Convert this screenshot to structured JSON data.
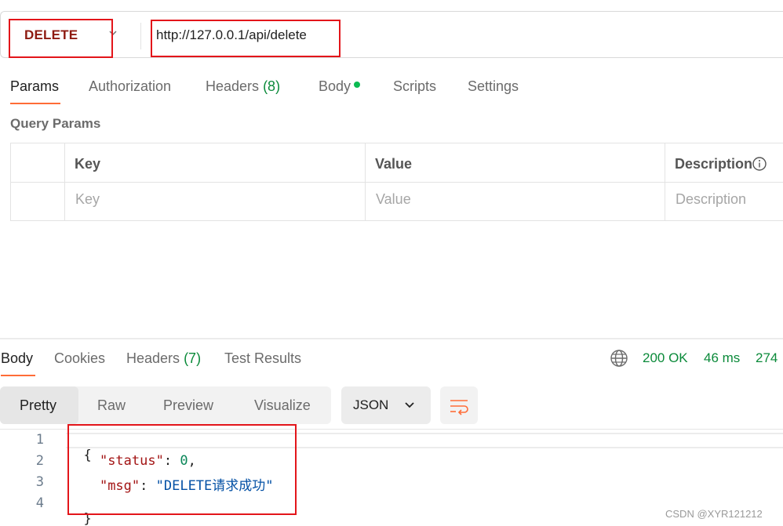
{
  "request": {
    "method": "DELETE",
    "url": "http://127.0.0.1/api/delete"
  },
  "request_tabs": {
    "params": "Params",
    "authorization": "Authorization",
    "headers": "Headers",
    "headers_count": "(8)",
    "body": "Body",
    "scripts": "Scripts",
    "settings": "Settings"
  },
  "query_params": {
    "title": "Query Params",
    "columns": [
      "Key",
      "Value",
      "Description"
    ],
    "placeholders": [
      "Key",
      "Value",
      "Description"
    ]
  },
  "response_tabs": {
    "body": "Body",
    "cookies": "Cookies",
    "headers": "Headers",
    "headers_count": "(7)",
    "test_results": "Test Results"
  },
  "response_status": {
    "status": "200 OK",
    "time": "46 ms",
    "size": "274"
  },
  "view_modes": [
    "Pretty",
    "Raw",
    "Preview",
    "Visualize"
  ],
  "format": "JSON",
  "code": {
    "line_numbers": [
      "1",
      "2",
      "3",
      "4"
    ],
    "open_brace": "{",
    "status_key": "\"status\"",
    "status_value": "0",
    "msg_key": "\"msg\"",
    "msg_value": "\"DELETE请求成功\"",
    "close_brace": "}",
    "colon": ": ",
    "comma": ","
  },
  "watermark": "CSDN @XYR121212",
  "colors": {
    "accent": "#ff6c37",
    "method": "#8e1a10",
    "status_ok": "#0b8a3a",
    "highlight_box": "#e3151a"
  },
  "icons": [
    "chevron-down-icon",
    "info-icon",
    "globe-icon",
    "wrap-lines-icon"
  ]
}
